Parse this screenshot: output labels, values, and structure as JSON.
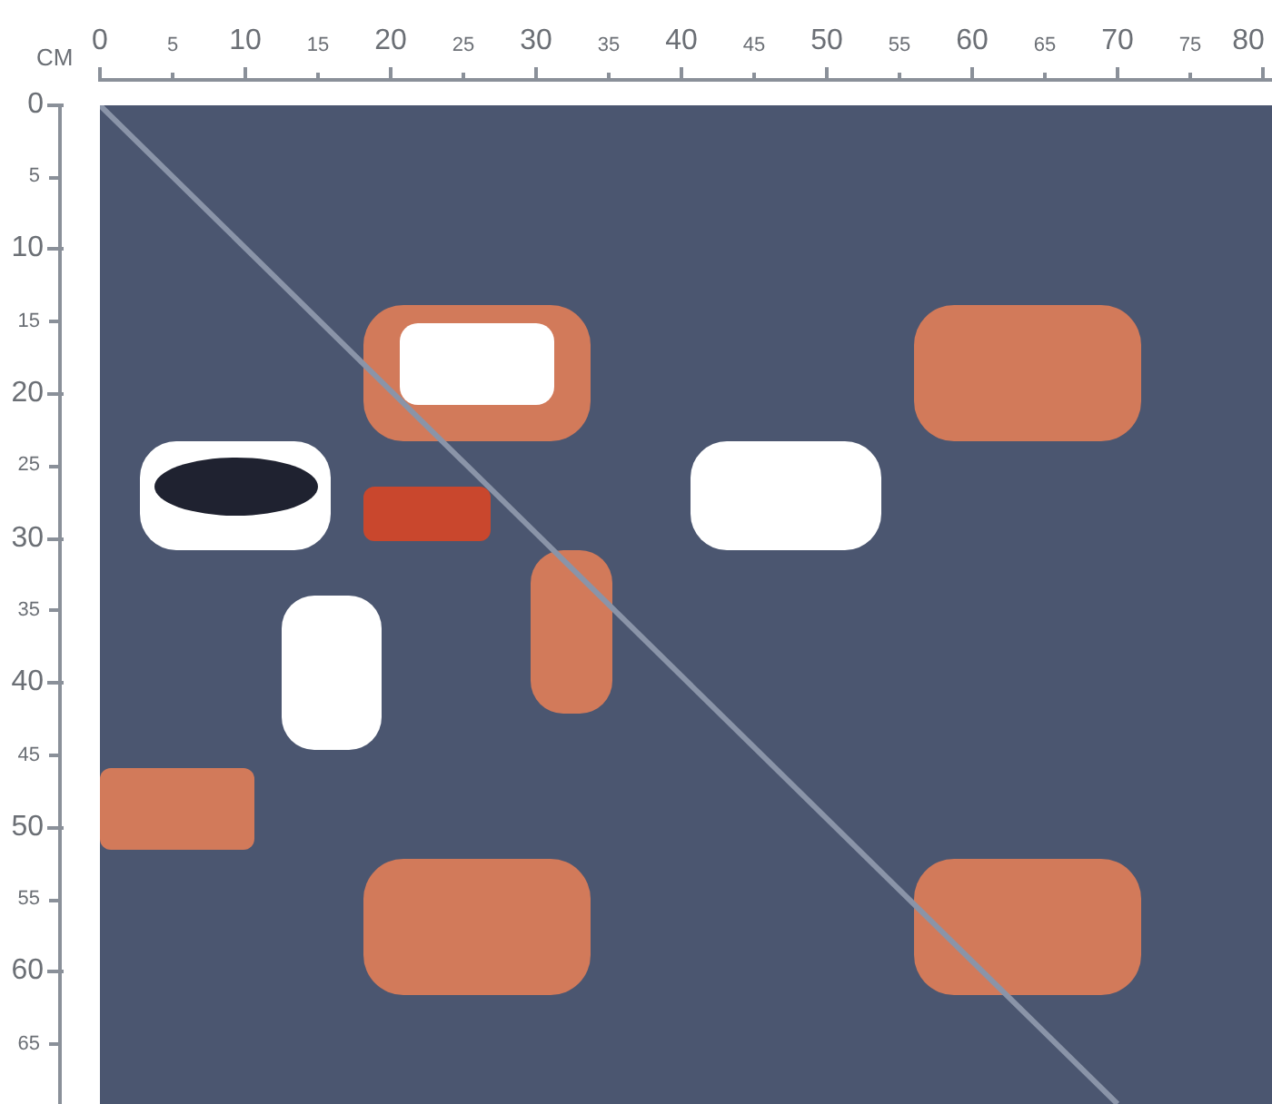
{
  "ruler": {
    "unit": "CM",
    "horizontal": [
      {
        "label": "0",
        "kind": "major"
      },
      {
        "label": "5",
        "kind": "minor"
      },
      {
        "label": "10",
        "kind": "major"
      },
      {
        "label": "15",
        "kind": "minor"
      },
      {
        "label": "20",
        "kind": "major"
      },
      {
        "label": "25",
        "kind": "minor"
      },
      {
        "label": "30",
        "kind": "major"
      },
      {
        "label": "35",
        "kind": "minor"
      },
      {
        "label": "40",
        "kind": "major"
      },
      {
        "label": "45",
        "kind": "minor"
      },
      {
        "label": "50",
        "kind": "major"
      },
      {
        "label": "55",
        "kind": "minor"
      },
      {
        "label": "60",
        "kind": "major"
      },
      {
        "label": "65",
        "kind": "minor"
      },
      {
        "label": "70",
        "kind": "major"
      },
      {
        "label": "75",
        "kind": "minor"
      },
      {
        "label": "80",
        "kind": "major"
      }
    ],
    "vertical": [
      {
        "label": "0",
        "kind": "major"
      },
      {
        "label": "5",
        "kind": "minor"
      },
      {
        "label": "10",
        "kind": "major"
      },
      {
        "label": "15",
        "kind": "minor"
      },
      {
        "label": "20",
        "kind": "major"
      },
      {
        "label": "25",
        "kind": "minor"
      },
      {
        "label": "30",
        "kind": "major"
      },
      {
        "label": "35",
        "kind": "minor"
      },
      {
        "label": "40",
        "kind": "major"
      },
      {
        "label": "45",
        "kind": "minor"
      },
      {
        "label": "50",
        "kind": "major"
      },
      {
        "label": "55",
        "kind": "minor"
      },
      {
        "label": "60",
        "kind": "major"
      },
      {
        "label": "65",
        "kind": "minor"
      }
    ]
  }
}
